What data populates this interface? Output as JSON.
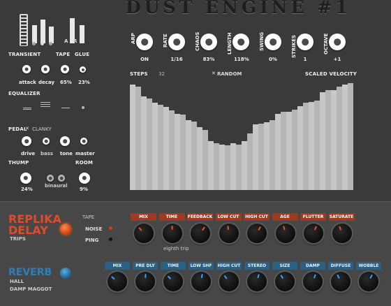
{
  "title": "DUST ENGINE #1",
  "left": {
    "transient_label": "TRANSIENT",
    "tape_label": "TAPE",
    "glue_label": "GLUE",
    "tape_letter_a": "A",
    "tape_letter_r": "R",
    "attack_label": "attack",
    "decay_label": "decay",
    "tape_value": "65%",
    "glue_value": "23%",
    "equalizer_label": "EQUALIZER",
    "pedal_label": "PEDAL",
    "pedal_type": "CLANKY",
    "drive_label": "drive",
    "bass_label": "bass",
    "tone_label": "tone",
    "master_label": "master",
    "thump_label": "THUMP",
    "room_label": "ROOM",
    "thump_value": "24%",
    "binaural_label": "binaural",
    "room_value": "9%"
  },
  "top_controls": [
    {
      "label": "ARP",
      "value": "ON"
    },
    {
      "label": "RATE",
      "value": "1/16"
    },
    {
      "label": "CHAOS",
      "value": "83%"
    },
    {
      "label": "LENGTH",
      "value": "118%"
    },
    {
      "label": "SWING",
      "value": "0%"
    },
    {
      "label": "STRIKES",
      "value": "1"
    },
    {
      "label": "OCTAVE",
      "value": "+1"
    }
  ],
  "sequencer": {
    "steps_label": "STEPS",
    "steps_value": "32",
    "random_label": "RANDOM",
    "scaled_label": "SCALED VELOCITY",
    "bar_levels": [
      0.97,
      0.95,
      0.86,
      0.84,
      0.8,
      0.78,
      0.76,
      0.73,
      0.7,
      0.69,
      0.64,
      0.63,
      0.58,
      0.55,
      0.45,
      0.43,
      0.42,
      0.41,
      0.43,
      0.42,
      0.45,
      0.52,
      0.6,
      0.61,
      0.62,
      0.64,
      0.7,
      0.72,
      0.72,
      0.74,
      0.77,
      0.8,
      0.81,
      0.82,
      0.9,
      0.92,
      0.92,
      0.95,
      0.97,
      0.98
    ]
  },
  "replika": {
    "name_line1": "REPLIKA",
    "name_line2": "DELAY",
    "mode": "TRIPS",
    "tape_label": "TAPE",
    "noise_label": "NOISE",
    "ping_label": "PING",
    "time_note": "eighth trip",
    "knobs": [
      "MIX",
      "TIME",
      "FEEDBACK",
      "LOW CUT",
      "HIGH CUT",
      "AGE",
      "FLUTTER",
      "SATURATE"
    ]
  },
  "reverb": {
    "name": "REVERB",
    "mode1": "HALL",
    "mode2": "DAMP MAGGOT",
    "knobs": [
      "MIX",
      "PRE DLY",
      "TIME",
      "LOW SHF",
      "HIGH CUT",
      "STEREO",
      "SIZE",
      "DAMP",
      "DIFFUSE",
      "WOBBLE"
    ]
  },
  "colors": {
    "accent_red": "#e24a2b",
    "accent_blue": "#2f7fb5",
    "background": "#3a3a3a"
  }
}
